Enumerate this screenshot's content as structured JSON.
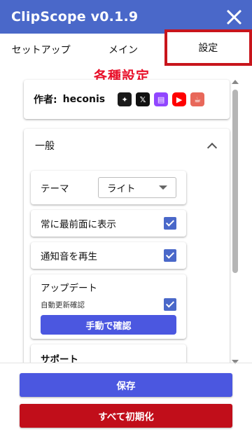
{
  "app": {
    "title": "ClipScope v0.1.9"
  },
  "tabs": [
    {
      "label": "セットアップ"
    },
    {
      "label": "メイン"
    },
    {
      "label": "設定",
      "active": true
    }
  ],
  "annotation": "各種設定",
  "author": {
    "label": "作者:",
    "name": "heconis",
    "icons": [
      "app-icon",
      "x-icon",
      "twitch-icon",
      "youtube-icon",
      "kofi-icon"
    ]
  },
  "general": {
    "title": "一般",
    "theme": {
      "label": "テーマ",
      "value": "ライト"
    },
    "always_on_top": {
      "label": "常に最前面に表示",
      "checked": true
    },
    "notification_sound": {
      "label": "通知音を再生",
      "checked": true
    },
    "update": {
      "title": "アップデート",
      "auto_check_label": "自動更新確認",
      "auto_check": true,
      "manual_button": "手動で確認"
    },
    "support": {
      "title": "サポート"
    }
  },
  "footer": {
    "save_label": "保存",
    "reset_label": "すべて初期化"
  },
  "colors": {
    "accent": "#4a68c9",
    "primary_button": "#4b57e0",
    "danger": "#c10e1a",
    "annotation": "#e8102a"
  }
}
